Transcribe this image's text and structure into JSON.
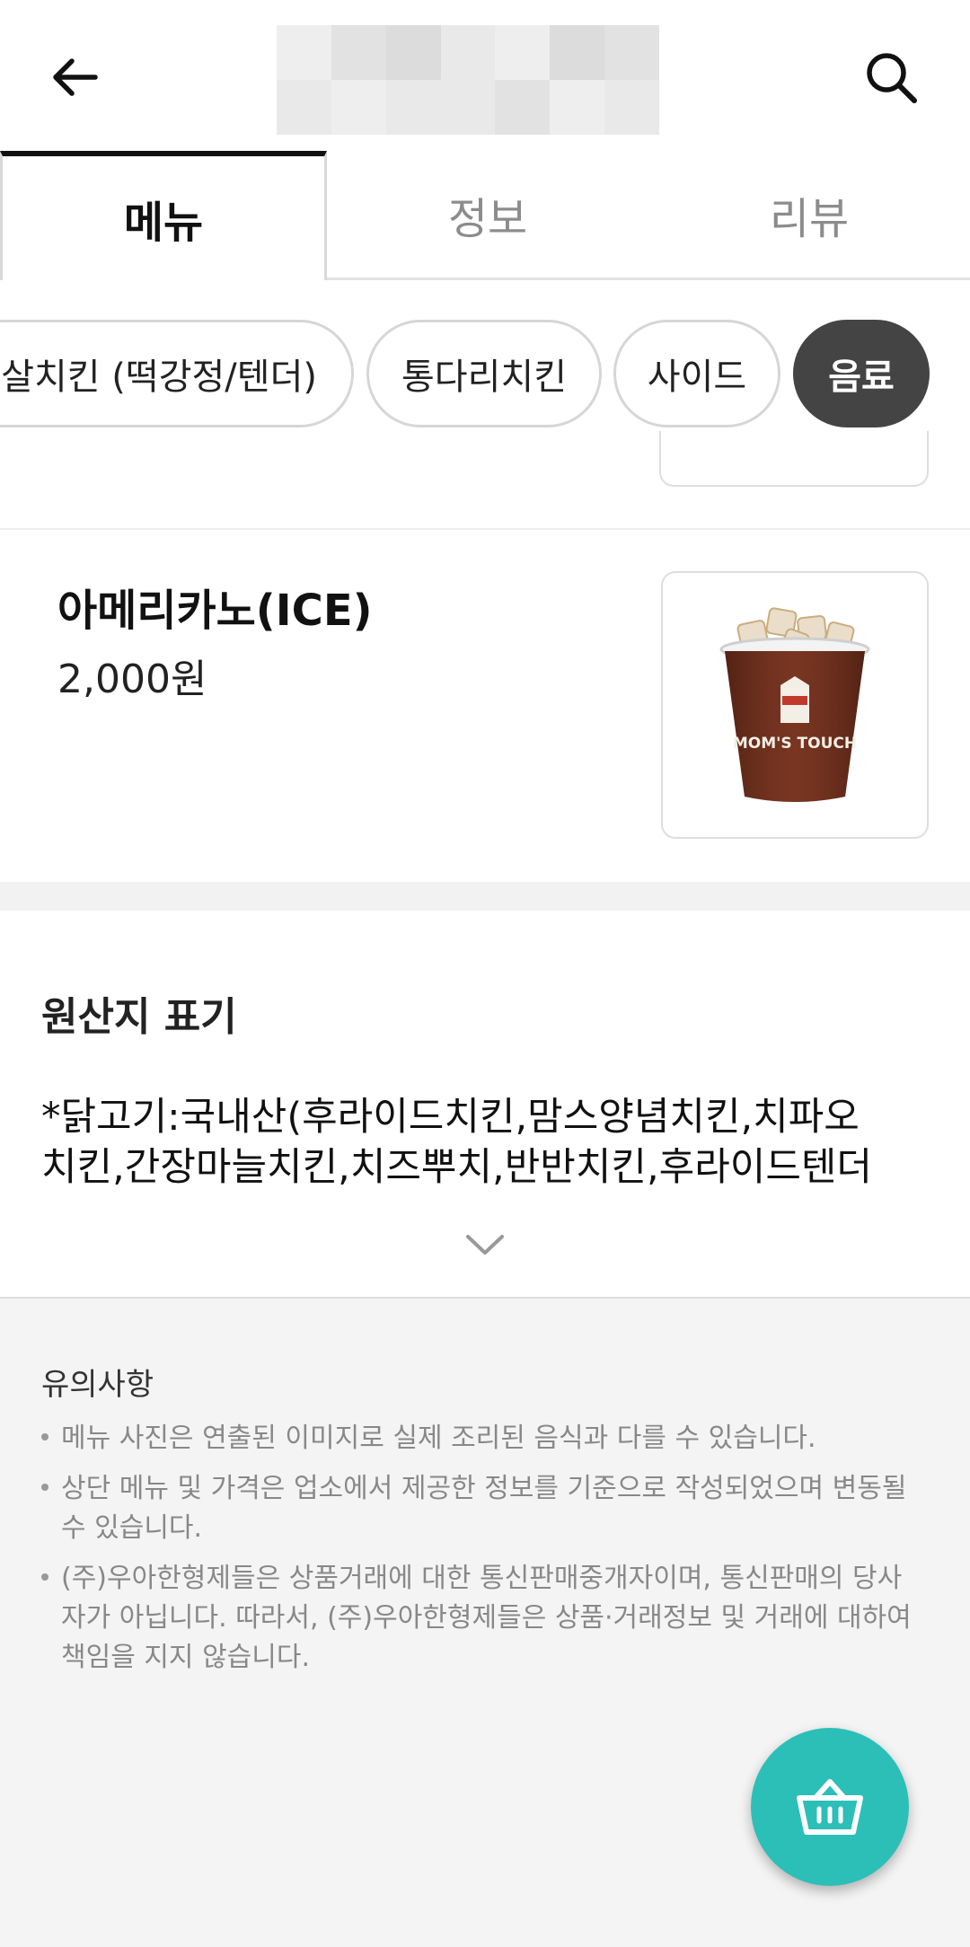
{
  "header": {
    "back_icon": "arrow-left-icon",
    "search_icon": "search-icon"
  },
  "tabs": [
    {
      "label": "메뉴",
      "active": true
    },
    {
      "label": "정보",
      "active": false
    },
    {
      "label": "리뷰",
      "active": false
    }
  ],
  "categories": [
    {
      "label": "순살치킨 (떡강정/텐더)",
      "active": false
    },
    {
      "label": "통다리치킨",
      "active": false
    },
    {
      "label": "사이드",
      "active": false
    },
    {
      "label": "음료",
      "active": true
    }
  ],
  "menu_item": {
    "name": "아메리카노(ICE)",
    "price": "2,000원",
    "image": "iced-americano-cup",
    "cup_text": "MOM'S TOUCH"
  },
  "origin": {
    "title": "원산지 표기",
    "line1": "*닭고기:국내산(후라이드치킨,맘스양념치킨,치파오",
    "line2": "치킨,간장마늘치킨,치즈뿌치,반반치킨,후라이드텐더",
    "expand_icon": "chevron-down-icon"
  },
  "notice": {
    "title": "유의사항",
    "items": [
      "메뉴 사진은 연출된 이미지로 실제 조리된 음식과 다를 수 있습니다.",
      "상단 메뉴 및 가격은 업소에서 제공한 정보를 기준으로 작성되었으며 변동될 수 있습니다.",
      "(주)우아한형제들은 상품거래에 대한 통신판매중개자이며, 통신판매의 당사자가 아닙니다. 따라서, (주)우아한형제들은 상품·거래정보 및 거래에 대하여 책임을 지지 않습니다."
    ]
  },
  "cart": {
    "icon": "basket-icon",
    "color": "#2bbfb8"
  }
}
